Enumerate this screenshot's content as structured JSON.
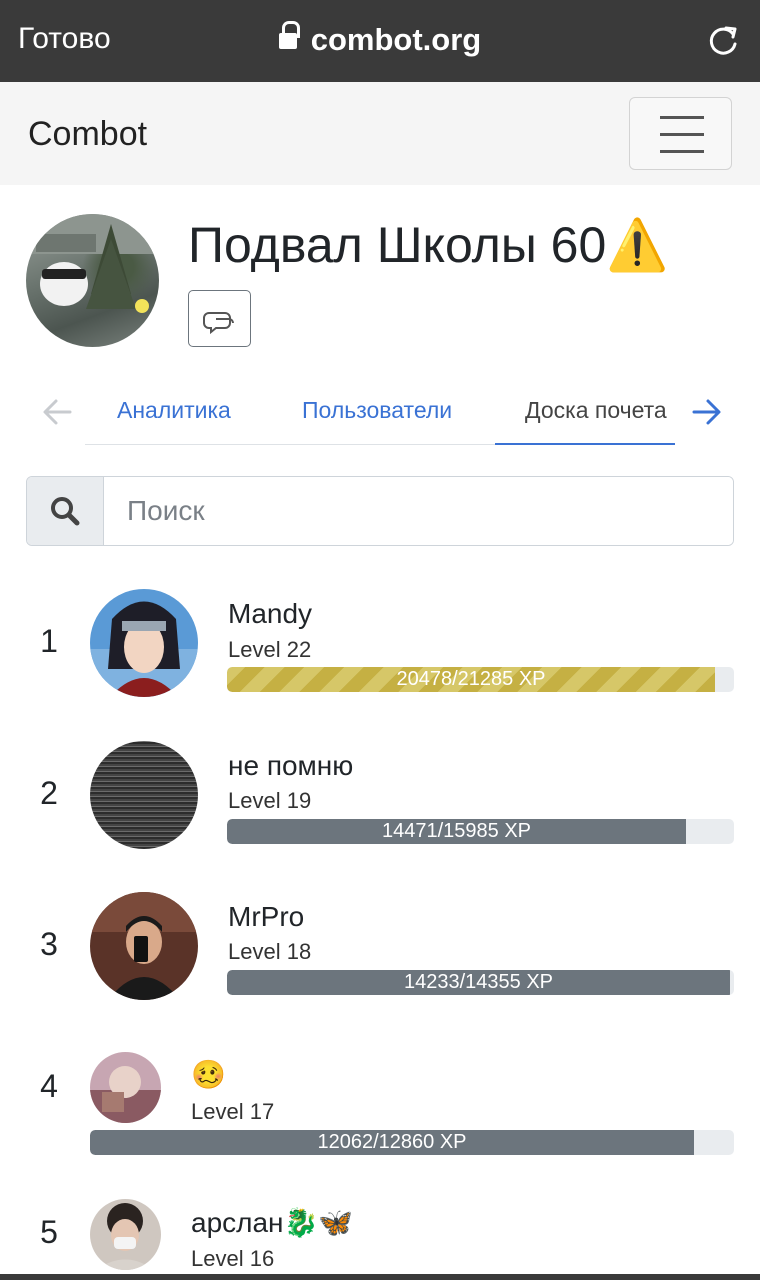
{
  "browser": {
    "done_label": "Готово",
    "url": "combot.org",
    "lock_icon": "lock-icon",
    "reload_icon": "reload-icon"
  },
  "navbar": {
    "brand": "Combot",
    "menu_icon": "hamburger-menu-icon"
  },
  "group": {
    "title": "Подвал Школы 60⚠️",
    "chat_icon": "chat-bubbles-icon"
  },
  "tabs": {
    "items": [
      {
        "label": "Аналитика",
        "active": false
      },
      {
        "label": "Пользователи",
        "active": false
      },
      {
        "label": "Доска почета",
        "active": true
      }
    ],
    "accent": "#3a72d4"
  },
  "search": {
    "placeholder": "Поиск",
    "value": ""
  },
  "leaderboard": [
    {
      "rank": "1",
      "name": "Mandy",
      "level": "Level 22",
      "xp_text": "20478/21285 XP",
      "progress": 0.9621,
      "highlight": true
    },
    {
      "rank": "2",
      "name": "не помню",
      "level": "Level 19",
      "xp_text": "14471/15985 XP",
      "progress": 0.9053,
      "highlight": false
    },
    {
      "rank": "3",
      "name": "MrPro",
      "level": "Level 18",
      "xp_text": "14233/14355 XP",
      "progress": 0.9915,
      "highlight": false
    },
    {
      "rank": "4",
      "name": "🥴",
      "level": "Level 17",
      "xp_text": "12062/12860 XP",
      "progress": 0.9379,
      "highlight": false
    },
    {
      "rank": "5",
      "name": "арслан🐉🦋",
      "level": "Level 16",
      "xp_text": "",
      "progress": null,
      "highlight": false
    }
  ],
  "colors": {
    "progress_gold": "#c5b043",
    "progress_gray": "#6c757d",
    "track": "#e9ecef"
  }
}
